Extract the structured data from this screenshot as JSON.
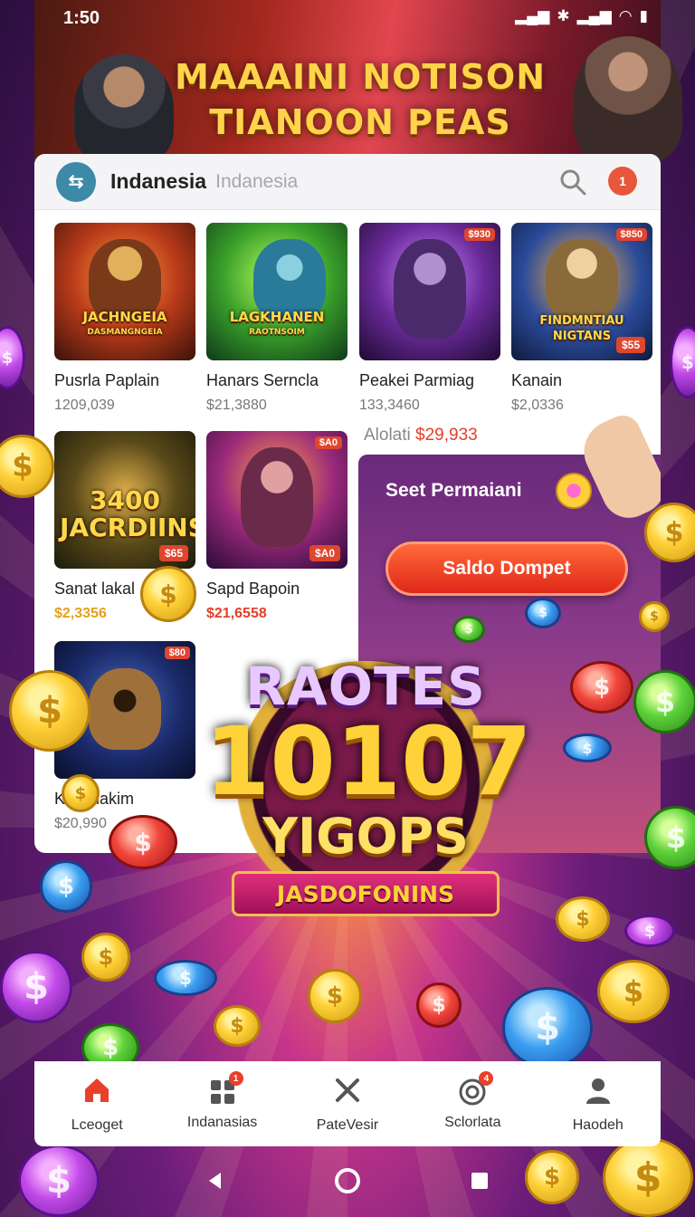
{
  "status_bar": {
    "time": "1:50",
    "icons": [
      "signal-icon",
      "bluetooth-icon",
      "signal-icon",
      "wifi-icon",
      "battery-icon"
    ]
  },
  "banner": {
    "title_line1": "MAAAINI NOTISON",
    "title_line2": "TIANOON PEAS"
  },
  "header": {
    "app_name": "Indanesia",
    "subtitle": "Indanesia",
    "notification_badge": "1"
  },
  "games": [
    {
      "thumb_label": "JACHNGEIA",
      "thumb_sub": "DASMANGNGEIA",
      "name": "Pusrla Paplain",
      "price": "1209,039",
      "price_style": "grey",
      "top_badge": "",
      "bottom_badge": ""
    },
    {
      "thumb_label": "LAGKHANEN",
      "thumb_sub": "RAOTNSOIM",
      "name": "Hanars Sernclа",
      "price": "$21,3880",
      "price_style": "grey",
      "top_badge": "",
      "bottom_badge": ""
    },
    {
      "thumb_label": "",
      "thumb_sub": "",
      "name": "Peakei Parmiag",
      "price": "133,3460",
      "price_style": "grey",
      "top_badge": "$930",
      "bottom_badge": ""
    },
    {
      "thumb_label": "FINDMNTIAU NIGTANS",
      "thumb_sub": "",
      "name": "Kanain",
      "price": "$2,0336",
      "price_style": "grey",
      "top_badge": "$850",
      "bottom_badge": "$55"
    },
    {
      "thumb_label": "3400 JACRDIINS",
      "thumb_sub": "",
      "name": "Sanat lakal",
      "price": "$2,3356",
      "price_style": "gold",
      "top_badge": "",
      "bottom_badge": "$65"
    },
    {
      "thumb_label": "",
      "thumb_sub": "",
      "name": "Sapd Bapoin",
      "price": "$21,6558",
      "price_style": "red",
      "top_badge": "$A0",
      "bottom_badge": "$A0"
    },
    {
      "thumb_label": "",
      "thumb_sub": "",
      "name": "Kastalakim",
      "price": "$20,990",
      "price_style": "grey",
      "top_badge": "$80",
      "bottom_badge": ""
    }
  ],
  "row_info": {
    "label": "Alolati",
    "amount": "$29,933"
  },
  "promo": {
    "title": "Seet Permaiani",
    "button_label": "Saldo Dompet"
  },
  "jackpot": {
    "line1": "RAOTES",
    "number": "10107",
    "line3": "YIGOPS",
    "ribbon": "JASDOFONINS"
  },
  "bottom_nav": [
    {
      "label": "Lceoget",
      "icon": "home-icon",
      "badge": "",
      "active": true
    },
    {
      "label": "Indanasias",
      "icon": "grid-icon",
      "badge": "1",
      "active": false
    },
    {
      "label": "PateVesir",
      "icon": "tools-icon",
      "badge": "",
      "active": false
    },
    {
      "label": "Sclorlata",
      "icon": "target-icon",
      "badge": "4",
      "active": false
    },
    {
      "label": "Haodeh",
      "icon": "user-icon",
      "badge": "",
      "active": false
    }
  ],
  "colors": {
    "accent": "#e02818",
    "gold": "#ffd23a",
    "active_nav": "#e8402a",
    "price_red": "#e2402a",
    "price_gold": "#e2a21a"
  }
}
